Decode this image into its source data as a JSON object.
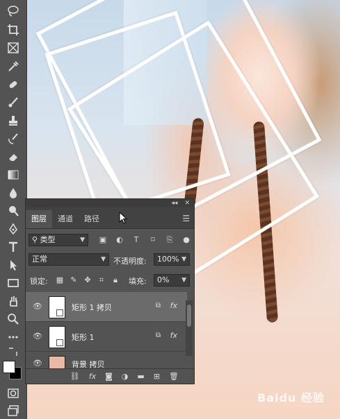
{
  "layers_panel": {
    "tabs": [
      {
        "label": "图层"
      },
      {
        "label": "通道"
      },
      {
        "label": "路径"
      }
    ],
    "filter": {
      "label": "类型"
    },
    "blend_mode": "正常",
    "opacity_label": "不透明度:",
    "opacity_value": "100%",
    "lock_label": "锁定:",
    "fill_label": "填充:",
    "fill_value": "0%",
    "layers": [
      {
        "name": "矩形 1 拷贝",
        "fx": "fx"
      },
      {
        "name": "矩形 1",
        "fx": "fx"
      },
      {
        "name": "背景 拷贝",
        "fx": ""
      }
    ]
  },
  "watermark": "Baidu 经验"
}
